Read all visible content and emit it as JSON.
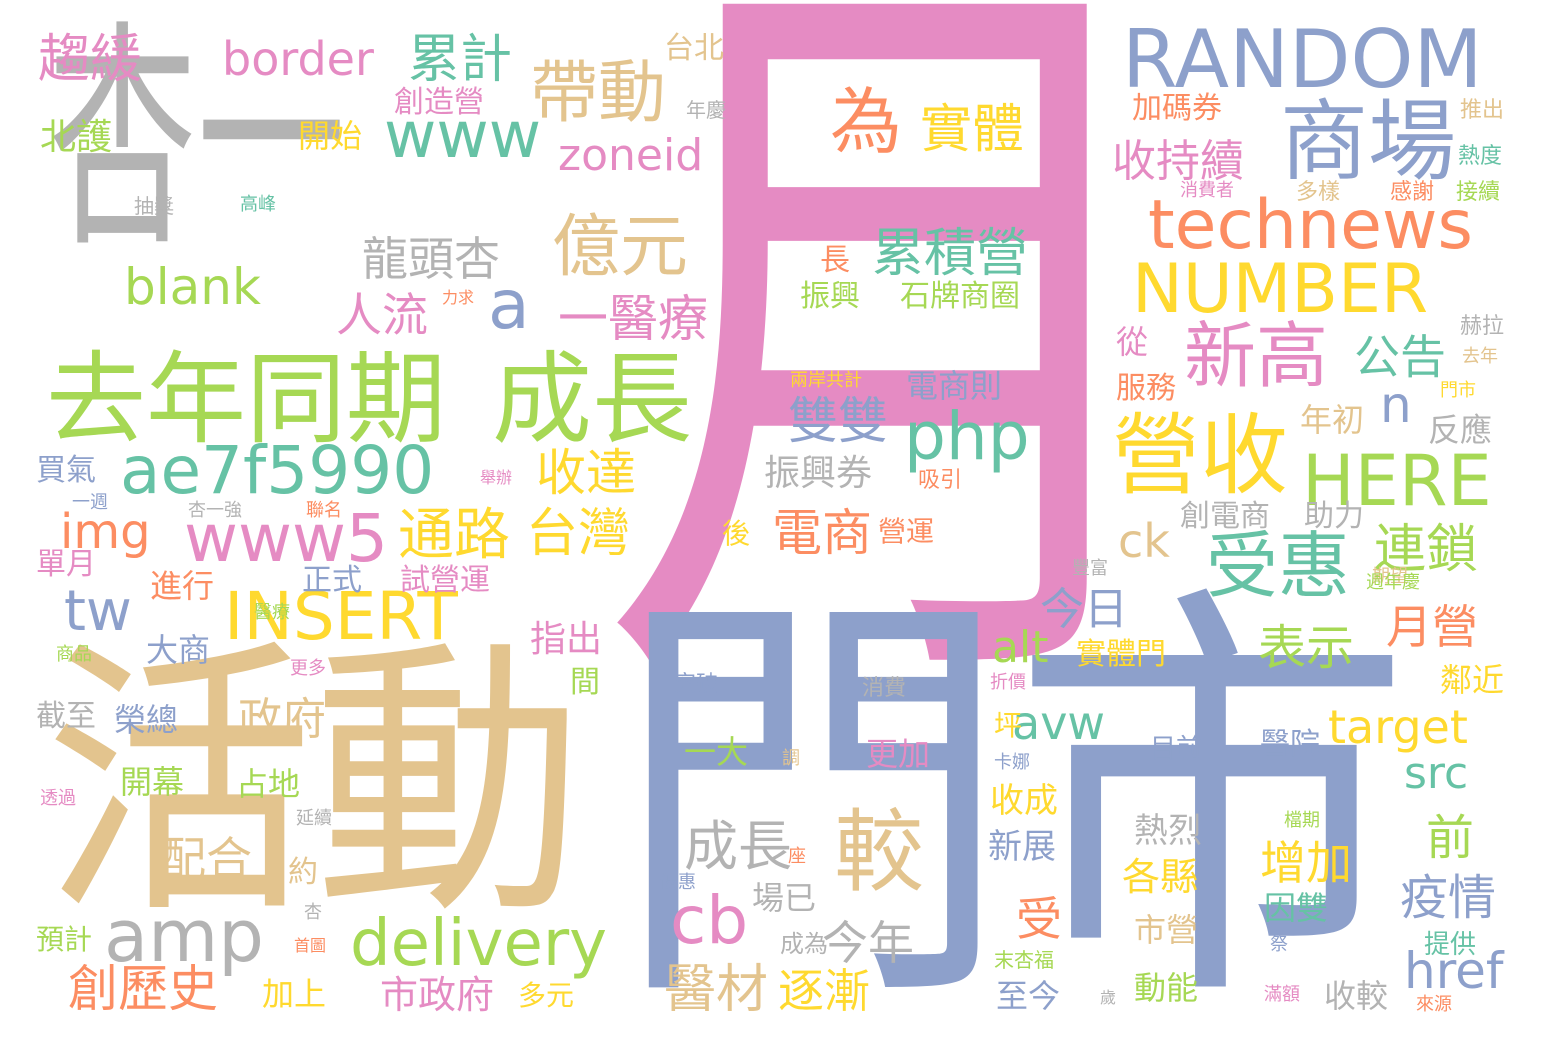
{
  "palette": {
    "pink": "#E58BC3",
    "gray": "#B3B3B3",
    "tan": "#E3C48E",
    "blue": "#8DA0CB",
    "green": "#A6D854",
    "teal": "#66C2A5",
    "orange": "#FC8D62",
    "yellow": "#FFD92F"
  },
  "words": [
    {
      "text": "月",
      "color": "#E58BC3"
    },
    {
      "text": "杏一",
      "color": "#B3B3B3"
    },
    {
      "text": "活動",
      "color": "#E3C48E"
    },
    {
      "text": "門市",
      "color": "#8DA0CB"
    },
    {
      "text": "去年同期",
      "color": "#A6D854"
    },
    {
      "text": "成長",
      "color": "#A6D854"
    },
    {
      "text": "RANDOM",
      "color": "#8DA0CB"
    },
    {
      "text": "商場",
      "color": "#8DA0CB"
    },
    {
      "text": "technews",
      "color": "#FC8D62"
    },
    {
      "text": "NUMBER",
      "color": "#FFD92F"
    },
    {
      "text": "營收",
      "color": "#FFD92F"
    },
    {
      "text": "HERE",
      "color": "#A6D854"
    },
    {
      "text": "新高",
      "color": "#E58BC3"
    },
    {
      "text": "受惠",
      "color": "#66C2A5"
    },
    {
      "text": "連鎖",
      "color": "#A6D854"
    },
    {
      "text": "為",
      "color": "#FC8D62"
    },
    {
      "text": "實體",
      "color": "#FFD92F"
    },
    {
      "text": "帶動",
      "color": "#E3C48E"
    },
    {
      "text": "www",
      "color": "#66C2A5"
    },
    {
      "text": "zoneid",
      "color": "#E58BC3"
    },
    {
      "text": "border",
      "color": "#E58BC3"
    },
    {
      "text": "累計",
      "color": "#66C2A5"
    },
    {
      "text": "趨緩",
      "color": "#E58BC3"
    },
    {
      "text": "台北",
      "color": "#E3C48E"
    },
    {
      "text": "創造營",
      "color": "#E58BC3"
    },
    {
      "text": "開始",
      "color": "#FFD92F"
    },
    {
      "text": "北護",
      "color": "#A6D854"
    },
    {
      "text": "億元",
      "color": "#E3C48E"
    },
    {
      "text": "累積營",
      "color": "#66C2A5"
    },
    {
      "text": "龍頭杏",
      "color": "#B3B3B3"
    },
    {
      "text": "blank",
      "color": "#A6D854"
    },
    {
      "text": "a",
      "color": "#8DA0CB"
    },
    {
      "text": "一醫療",
      "color": "#E58BC3"
    },
    {
      "text": "人流",
      "color": "#E58BC3"
    },
    {
      "text": "php",
      "color": "#66C2A5"
    },
    {
      "text": "ae7f5990",
      "color": "#66C2A5"
    },
    {
      "text": "雙雙",
      "color": "#8DA0CB"
    },
    {
      "text": "收達",
      "color": "#FFD92F"
    },
    {
      "text": "www5",
      "color": "#E58BC3"
    },
    {
      "text": "通路",
      "color": "#FFD92F"
    },
    {
      "text": "台灣",
      "color": "#FFD92F"
    },
    {
      "text": "電商",
      "color": "#FC8D62"
    },
    {
      "text": "振興券",
      "color": "#B3B3B3"
    },
    {
      "text": "img",
      "color": "#FC8D62"
    },
    {
      "text": "tw",
      "color": "#8DA0CB"
    },
    {
      "text": "INSERT",
      "color": "#FFD92F"
    },
    {
      "text": "收持續",
      "color": "#E58BC3"
    },
    {
      "text": "公告",
      "color": "#66C2A5"
    },
    {
      "text": "n",
      "color": "#8DA0CB"
    },
    {
      "text": "年初",
      "color": "#E3C48E"
    },
    {
      "text": "反應",
      "color": "#B3B3B3"
    },
    {
      "text": "ck",
      "color": "#E3C48E"
    },
    {
      "text": "今日",
      "color": "#8DA0CB"
    },
    {
      "text": "月營",
      "color": "#FC8D62"
    },
    {
      "text": "表示",
      "color": "#A6D854"
    },
    {
      "text": "alt",
      "color": "#A6D854"
    },
    {
      "text": "實體門",
      "color": "#FFD92F"
    },
    {
      "text": "avw",
      "color": "#66C2A5"
    },
    {
      "text": "target",
      "color": "#FFD92F"
    },
    {
      "text": "src",
      "color": "#66C2A5"
    },
    {
      "text": "成長",
      "color": "#B3B3B3"
    },
    {
      "text": "較",
      "color": "#E3C48E"
    },
    {
      "text": "cb",
      "color": "#E58BC3"
    },
    {
      "text": "amp",
      "color": "#B3B3B3"
    },
    {
      "text": "delivery",
      "color": "#A6D854"
    },
    {
      "text": "今年",
      "color": "#B3B3B3"
    },
    {
      "text": "創歷史",
      "color": "#FC8D62"
    },
    {
      "text": "醫材",
      "color": "#E3C48E"
    },
    {
      "text": "逐漸",
      "color": "#FFD92F"
    },
    {
      "text": "市政府",
      "color": "#E58BC3"
    },
    {
      "text": "配合",
      "color": "#E3C48E"
    },
    {
      "text": "政府",
      "color": "#E3C48E"
    },
    {
      "text": "增加",
      "color": "#FFD92F"
    },
    {
      "text": "疫情",
      "color": "#8DA0CB"
    },
    {
      "text": "前",
      "color": "#A6D854"
    },
    {
      "text": "href",
      "color": "#8DA0CB"
    },
    {
      "text": "長",
      "color": "#FC8D62"
    },
    {
      "text": "振興",
      "color": "#A6D854"
    },
    {
      "text": "石牌商圈",
      "color": "#A6D854"
    },
    {
      "text": "電商則",
      "color": "#8DA0CB"
    },
    {
      "text": "加碼券",
      "color": "#FC8D62"
    },
    {
      "text": "從",
      "color": "#E58BC3"
    },
    {
      "text": "服務",
      "color": "#FC8D62"
    },
    {
      "text": "大商",
      "color": "#8DA0CB"
    },
    {
      "text": "進行",
      "color": "#FC8D62"
    },
    {
      "text": "正式",
      "color": "#8DA0CB"
    },
    {
      "text": "試營運",
      "color": "#E58BC3"
    },
    {
      "text": "指出",
      "color": "#E58BC3"
    },
    {
      "text": "間",
      "color": "#A6D854"
    },
    {
      "text": "榮總",
      "color": "#8DA0CB"
    },
    {
      "text": "開幕",
      "color": "#A6D854"
    },
    {
      "text": "占地",
      "color": "#A6D854"
    },
    {
      "text": "截至",
      "color": "#B3B3B3"
    },
    {
      "text": "買氣",
      "color": "#8DA0CB"
    },
    {
      "text": "單月",
      "color": "#E58BC3"
    },
    {
      "text": "預計",
      "color": "#A6D854"
    },
    {
      "text": "加上",
      "color": "#FFD92F"
    },
    {
      "text": "多元",
      "color": "#FFD92F"
    },
    {
      "text": "約",
      "color": "#E3C48E"
    },
    {
      "text": "創電商",
      "color": "#B3B3B3"
    },
    {
      "text": "助力",
      "color": "#B3B3B3"
    },
    {
      "text": "後",
      "color": "#FFD92F"
    },
    {
      "text": "營運",
      "color": "#FC8D62"
    },
    {
      "text": "吸引",
      "color": "#FC8D62"
    },
    {
      "text": "一大",
      "color": "#A6D854"
    },
    {
      "text": "更加",
      "color": "#E58BC3"
    },
    {
      "text": "突破",
      "color": "#8DA0CB"
    },
    {
      "text": "消費",
      "color": "#B3B3B3"
    },
    {
      "text": "坪",
      "color": "#FFD92F"
    },
    {
      "text": "收成",
      "color": "#FFD92F"
    },
    {
      "text": "新展",
      "color": "#8DA0CB"
    },
    {
      "text": "熱烈",
      "color": "#B3B3B3"
    },
    {
      "text": "各縣",
      "color": "#FFD92F"
    },
    {
      "text": "市營",
      "color": "#E3C48E"
    },
    {
      "text": "動能",
      "color": "#A6D854"
    },
    {
      "text": "場已",
      "color": "#B3B3B3"
    },
    {
      "text": "成為",
      "color": "#B3B3B3"
    },
    {
      "text": "受",
      "color": "#FC8D62"
    },
    {
      "text": "至今",
      "color": "#8DA0CB"
    },
    {
      "text": "收較",
      "color": "#B3B3B3"
    },
    {
      "text": "因雙",
      "color": "#66C2A5"
    },
    {
      "text": "提供",
      "color": "#66C2A5"
    },
    {
      "text": "鄰近",
      "color": "#FFD92F"
    },
    {
      "text": "目前",
      "color": "#8DA0CB"
    },
    {
      "text": "醫院",
      "color": "#8DA0CB"
    },
    {
      "text": "推出",
      "color": "#E3C48E"
    },
    {
      "text": "熱度",
      "color": "#66C2A5"
    },
    {
      "text": "接續",
      "color": "#A6D854"
    },
    {
      "text": "感謝",
      "color": "#FC8D62"
    },
    {
      "text": "多樣",
      "color": "#E3C48E"
    },
    {
      "text": "消費者",
      "color": "#E58BC3"
    },
    {
      "text": "年慶",
      "color": "#B3B3B3"
    },
    {
      "text": "赫拉",
      "color": "#B3B3B3"
    },
    {
      "text": "去年",
      "color": "#E3C48E"
    },
    {
      "text": "門市",
      "color": "#FFD92F"
    },
    {
      "text": "抽獎",
      "color": "#B3B3B3"
    },
    {
      "text": "高峰",
      "color": "#66C2A5"
    },
    {
      "text": "力求",
      "color": "#FC8D62"
    },
    {
      "text": "兩岸共計",
      "color": "#FFD92F"
    },
    {
      "text": "舉辦",
      "color": "#E58BC3"
    },
    {
      "text": "杏一強",
      "color": "#B3B3B3"
    },
    {
      "text": "一週",
      "color": "#8DA0CB"
    },
    {
      "text": "聯名",
      "color": "#FC8D62"
    },
    {
      "text": "醫療",
      "color": "#A6D854"
    },
    {
      "text": "商品",
      "color": "#A6D854"
    },
    {
      "text": "更多",
      "color": "#E58BC3"
    },
    {
      "text": "透過",
      "color": "#E58BC3"
    },
    {
      "text": "延續",
      "color": "#B3B3B3"
    },
    {
      "text": "杏",
      "color": "#B3B3B3"
    },
    {
      "text": "首圖",
      "color": "#FC8D62"
    },
    {
      "text": "末杏福",
      "color": "#A6D854"
    },
    {
      "text": "卡娜",
      "color": "#8DA0CB"
    },
    {
      "text": "優惠",
      "color": "#8DA0CB"
    },
    {
      "text": "座",
      "color": "#FC8D62"
    },
    {
      "text": "調",
      "color": "#E3C48E"
    },
    {
      "text": "折價",
      "color": "#E58BC3"
    },
    {
      "text": "豐富",
      "color": "#B3B3B3"
    },
    {
      "text": "期望",
      "color": "#E3C48E"
    },
    {
      "text": "週年慶",
      "color": "#A6D854"
    },
    {
      "text": "檔期",
      "color": "#A6D854"
    },
    {
      "text": "祭",
      "color": "#8DA0CB"
    },
    {
      "text": "滿額",
      "color": "#E58BC3"
    },
    {
      "text": "來源",
      "color": "#FC8D62"
    },
    {
      "text": "歲",
      "color": "#B3B3B3"
    }
  ]
}
